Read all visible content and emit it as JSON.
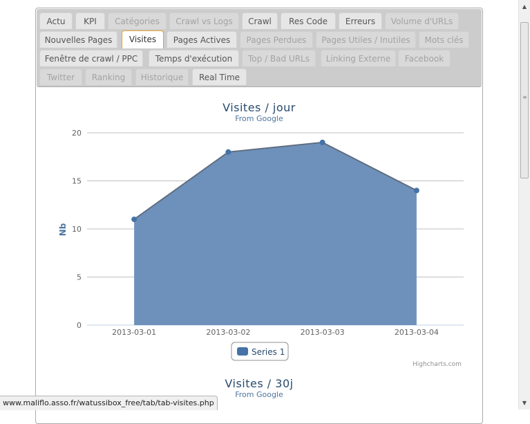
{
  "tabs": [
    {
      "label": "Actu",
      "state": "normal"
    },
    {
      "label": "KPI",
      "state": "normal"
    },
    {
      "label": "Catégories",
      "state": "disabled"
    },
    {
      "label": "Crawl vs Logs",
      "state": "disabled"
    },
    {
      "label": "Crawl",
      "state": "normal"
    },
    {
      "label": "Res Code",
      "state": "normal"
    },
    {
      "label": "Erreurs",
      "state": "normal"
    },
    {
      "label": "Volume d'URLs",
      "state": "disabled"
    },
    {
      "label": "Nouvelles Pages",
      "state": "normal"
    },
    {
      "label": "Visites",
      "state": "active"
    },
    {
      "label": "Pages Actives",
      "state": "normal"
    },
    {
      "label": "Pages Perdues",
      "state": "disabled"
    },
    {
      "label": "Pages Utiles / Inutiles",
      "state": "disabled"
    },
    {
      "label": "Mots clés",
      "state": "disabled"
    },
    {
      "label": "Fenêtre de crawl / PPC",
      "state": "normal"
    },
    {
      "label": "Temps d'exécution",
      "state": "normal"
    },
    {
      "label": "Top / Bad URLs",
      "state": "disabled"
    },
    {
      "label": "Linking Externe",
      "state": "disabled"
    },
    {
      "label": "Facebook",
      "state": "disabled"
    },
    {
      "label": "Twitter",
      "state": "disabled"
    },
    {
      "label": "Ranking",
      "state": "disabled"
    },
    {
      "label": "Historique",
      "state": "disabled"
    },
    {
      "label": "Real Time",
      "state": "normal"
    }
  ],
  "chart_data": {
    "type": "area",
    "title": "Visites / jour",
    "subtitle": "From Google",
    "categories": [
      "2013-03-01",
      "2013-03-02",
      "2013-03-03",
      "2013-03-04"
    ],
    "series": [
      {
        "name": "Series 1",
        "values": [
          11,
          18,
          19,
          14
        ]
      }
    ],
    "ylabel": "Nb",
    "xlabel": "",
    "ylim": [
      0,
      20
    ],
    "yticks": [
      0,
      5,
      10,
      15,
      20
    ],
    "grid": true,
    "legend": "bottom-center",
    "colors": {
      "fill": "#6e91bb",
      "line": "#5f6d80",
      "marker": "#4572a7"
    }
  },
  "credits": "Highcharts.com",
  "second_chart": {
    "title": "Visites / 30j",
    "subtitle": "From Google"
  },
  "status_url": "www.maliflo.asso.fr/watussibox_free/tab/tab-visites.php"
}
